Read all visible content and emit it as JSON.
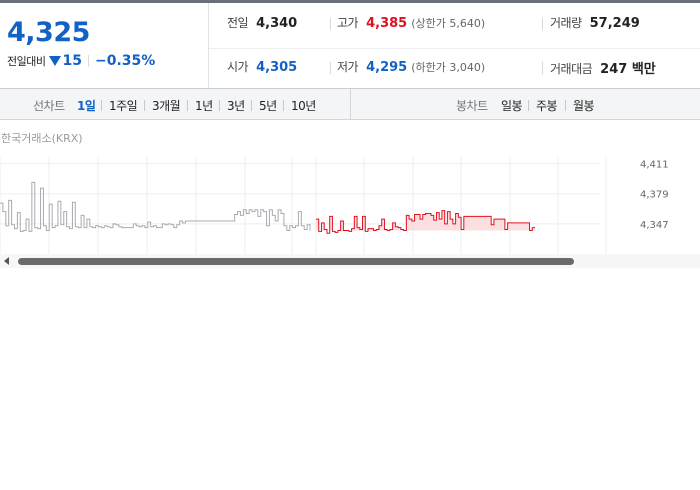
{
  "price": {
    "current": "4,325",
    "change_label": "전일대비",
    "change": "15",
    "change_rate": "−0.35%"
  },
  "stats": {
    "prev_close": {
      "label": "전일",
      "value": "4,340"
    },
    "high": {
      "label": "고가",
      "value": "4,385",
      "sub": "(상한가 5,640)"
    },
    "volume": {
      "label": "거래량",
      "value": "57,249"
    },
    "open": {
      "label": "시가",
      "value": "4,305"
    },
    "low": {
      "label": "저가",
      "value": "4,295",
      "sub": "(하한가 3,040)"
    },
    "amount": {
      "label": "거래대금",
      "value": "247 백만"
    }
  },
  "tabs": {
    "line_label": "선차트",
    "line": [
      "1일",
      "1주일",
      "3개월",
      "1년",
      "3년",
      "5년",
      "10년"
    ],
    "candle_label": "봉차트",
    "candle": [
      "일봉",
      "주봉",
      "월봉"
    ]
  },
  "colors": {
    "up": "#e0111f",
    "down": "#1261c4",
    "prev_line": "#a8abb2"
  },
  "chart_data": {
    "type": "line",
    "title": "",
    "source": "한국거래소(KRX)",
    "y_ticks": [
      "4,411",
      "4,379",
      "4,347"
    ],
    "ylim": [
      4315,
      4418
    ],
    "prev_close": 4340,
    "series": [
      {
        "color": "gray",
        "values": [
          4369,
          4360,
          4345,
          4372,
          4346,
          4342,
          4359,
          4339,
          4340,
          4352,
          4339,
          4391,
          4343,
          4342,
          4385,
          4345,
          4340,
          4368,
          4343,
          4345,
          4371,
          4346,
          4360,
          4344,
          4342,
          4370,
          4344,
          4343,
          4356,
          4343,
          4352,
          4344,
          4343,
          4345,
          4344,
          4343,
          4345,
          4344,
          4343,
          4347,
          4346,
          4344,
          4343,
          4343,
          4343,
          4343,
          4347,
          4345,
          4344,
          4345,
          4343,
          4349,
          4344,
          4345,
          4343,
          4343,
          4347,
          4346,
          4347,
          4346,
          4343,
          4346,
          4350,
          4348,
          4350,
          4350,
          4350,
          4350,
          4350,
          4350,
          4350,
          4350,
          4350,
          4350,
          4350,
          4350,
          4350,
          4350,
          4350,
          4350,
          4350,
          4357,
          4360,
          4356,
          4362,
          4358,
          4362,
          4360,
          4362,
          4355,
          4362,
          4360,
          4345,
          4362,
          4356,
          4350,
          4362,
          4358,
          4345,
          4340,
          4345,
          4343,
          4345,
          4360,
          4345,
          4341,
          4346,
          4340
        ]
      },
      {
        "color": "red",
        "values": [
          4352,
          4339,
          4348,
          4341,
          4337,
          4355,
          4339,
          4338,
          4340,
          4350,
          4340,
          4340,
          4339,
          4342,
          4355,
          4343,
          4341,
          4355,
          4339,
          4342,
          4342,
          4340,
          4341,
          4345,
          4352,
          4341,
          4340,
          4341,
          4348,
          4344,
          4343,
          4341,
          4340,
          4356,
          4352,
          4350,
          4357,
          4357,
          4352,
          4357,
          4358,
          4358,
          4356,
          4351,
          4359,
          4352,
          4361,
          4347,
          4360,
          4352,
          4347,
          4358,
          4354,
          4341,
          4355,
          4355,
          4355,
          4355,
          4355,
          4355,
          4355,
          4355,
          4355,
          4355,
          4346,
          4352,
          4352,
          4352,
          4352,
          4341,
          4348,
          4348,
          4348,
          4348,
          4348,
          4348,
          4348,
          4348,
          4340,
          4343,
          4343
        ]
      }
    ]
  }
}
